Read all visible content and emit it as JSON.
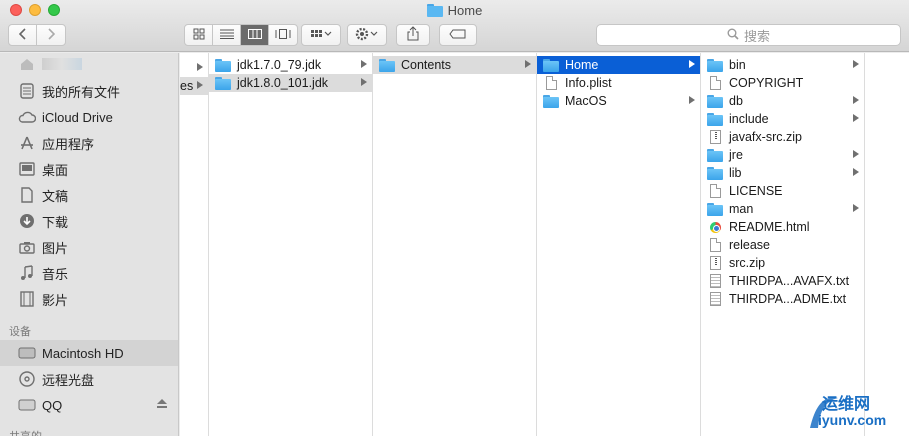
{
  "window": {
    "title": "Home"
  },
  "toolbar": {
    "search_placeholder": "搜索"
  },
  "sidebar": {
    "favorites": [
      {
        "label": "我的所有文件",
        "icon": "all-files-icon"
      },
      {
        "label": "iCloud Drive",
        "icon": "cloud-icon"
      },
      {
        "label": "应用程序",
        "icon": "applications-icon"
      },
      {
        "label": "桌面",
        "icon": "desktop-icon"
      },
      {
        "label": "文稿",
        "icon": "documents-icon"
      },
      {
        "label": "下载",
        "icon": "download-icon"
      },
      {
        "label": "图片",
        "icon": "camera-icon"
      },
      {
        "label": "音乐",
        "icon": "music-icon"
      },
      {
        "label": "影片",
        "icon": "film-icon"
      }
    ],
    "devices_header": "设备",
    "devices": [
      {
        "label": "Macintosh HD",
        "icon": "harddisk-icon"
      },
      {
        "label": "远程光盘",
        "icon": "disc-icon"
      },
      {
        "label": "QQ",
        "icon": "drive-icon"
      }
    ],
    "shared_header": "共享的"
  },
  "columns": {
    "col0": {
      "items": [
        {
          "label": "es"
        }
      ]
    },
    "col1": {
      "items": [
        {
          "label": "jdk1.7.0_79.jdk",
          "type": "folder"
        },
        {
          "label": "jdk1.8.0_101.jdk",
          "type": "folder"
        }
      ]
    },
    "col2": {
      "items": [
        {
          "label": "Contents",
          "type": "folder"
        }
      ]
    },
    "col3": {
      "items": [
        {
          "label": "Home",
          "type": "folder"
        },
        {
          "label": "Info.plist",
          "type": "doc"
        },
        {
          "label": "MacOS",
          "type": "folder"
        }
      ]
    },
    "col4": {
      "items": [
        {
          "label": "bin",
          "type": "folder"
        },
        {
          "label": "COPYRIGHT",
          "type": "doc"
        },
        {
          "label": "db",
          "type": "folder"
        },
        {
          "label": "include",
          "type": "folder"
        },
        {
          "label": "javafx-src.zip",
          "type": "zip"
        },
        {
          "label": "jre",
          "type": "folder"
        },
        {
          "label": "lib",
          "type": "folder"
        },
        {
          "label": "LICENSE",
          "type": "doc"
        },
        {
          "label": "man",
          "type": "folder"
        },
        {
          "label": "README.html",
          "type": "html"
        },
        {
          "label": "release",
          "type": "doc"
        },
        {
          "label": "src.zip",
          "type": "zip"
        },
        {
          "label": "THIRDPA...AVAFX.txt",
          "type": "txt"
        },
        {
          "label": "THIRDPA...ADME.txt",
          "type": "txt"
        }
      ]
    }
  },
  "watermark": {
    "line1": "运维网",
    "line2": "iyunv.com"
  }
}
